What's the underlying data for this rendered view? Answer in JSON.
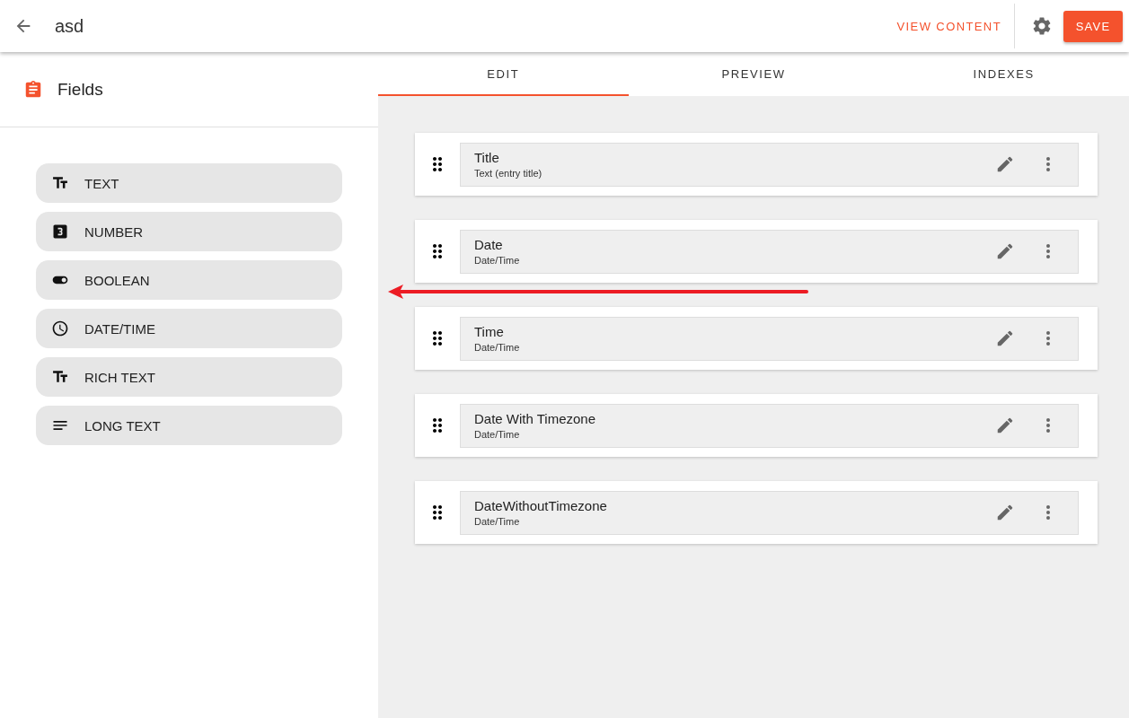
{
  "header": {
    "title": "asd",
    "view_content": "VIEW CONTENT",
    "save": "SAVE"
  },
  "sidebar": {
    "title": "Fields",
    "items": [
      {
        "kind": "text",
        "label": "TEXT"
      },
      {
        "kind": "number",
        "label": "NUMBER"
      },
      {
        "kind": "boolean",
        "label": "BOOLEAN"
      },
      {
        "kind": "datetime",
        "label": "DATE/TIME"
      },
      {
        "kind": "richtext",
        "label": "RICH TEXT"
      },
      {
        "kind": "longtext",
        "label": "LONG TEXT"
      }
    ]
  },
  "tabs": [
    {
      "label": "EDIT",
      "selected": true
    },
    {
      "label": "PREVIEW",
      "selected": false
    },
    {
      "label": "INDEXES",
      "selected": false
    }
  ],
  "fields": [
    {
      "name": "Title",
      "type": "Text (entry title)"
    },
    {
      "name": "Date",
      "type": "Date/Time"
    },
    {
      "name": "Time",
      "type": "Date/Time"
    },
    {
      "name": "Date With Timezone",
      "type": "Date/Time"
    },
    {
      "name": "DateWithoutTimezone",
      "type": "Date/Time"
    }
  ]
}
